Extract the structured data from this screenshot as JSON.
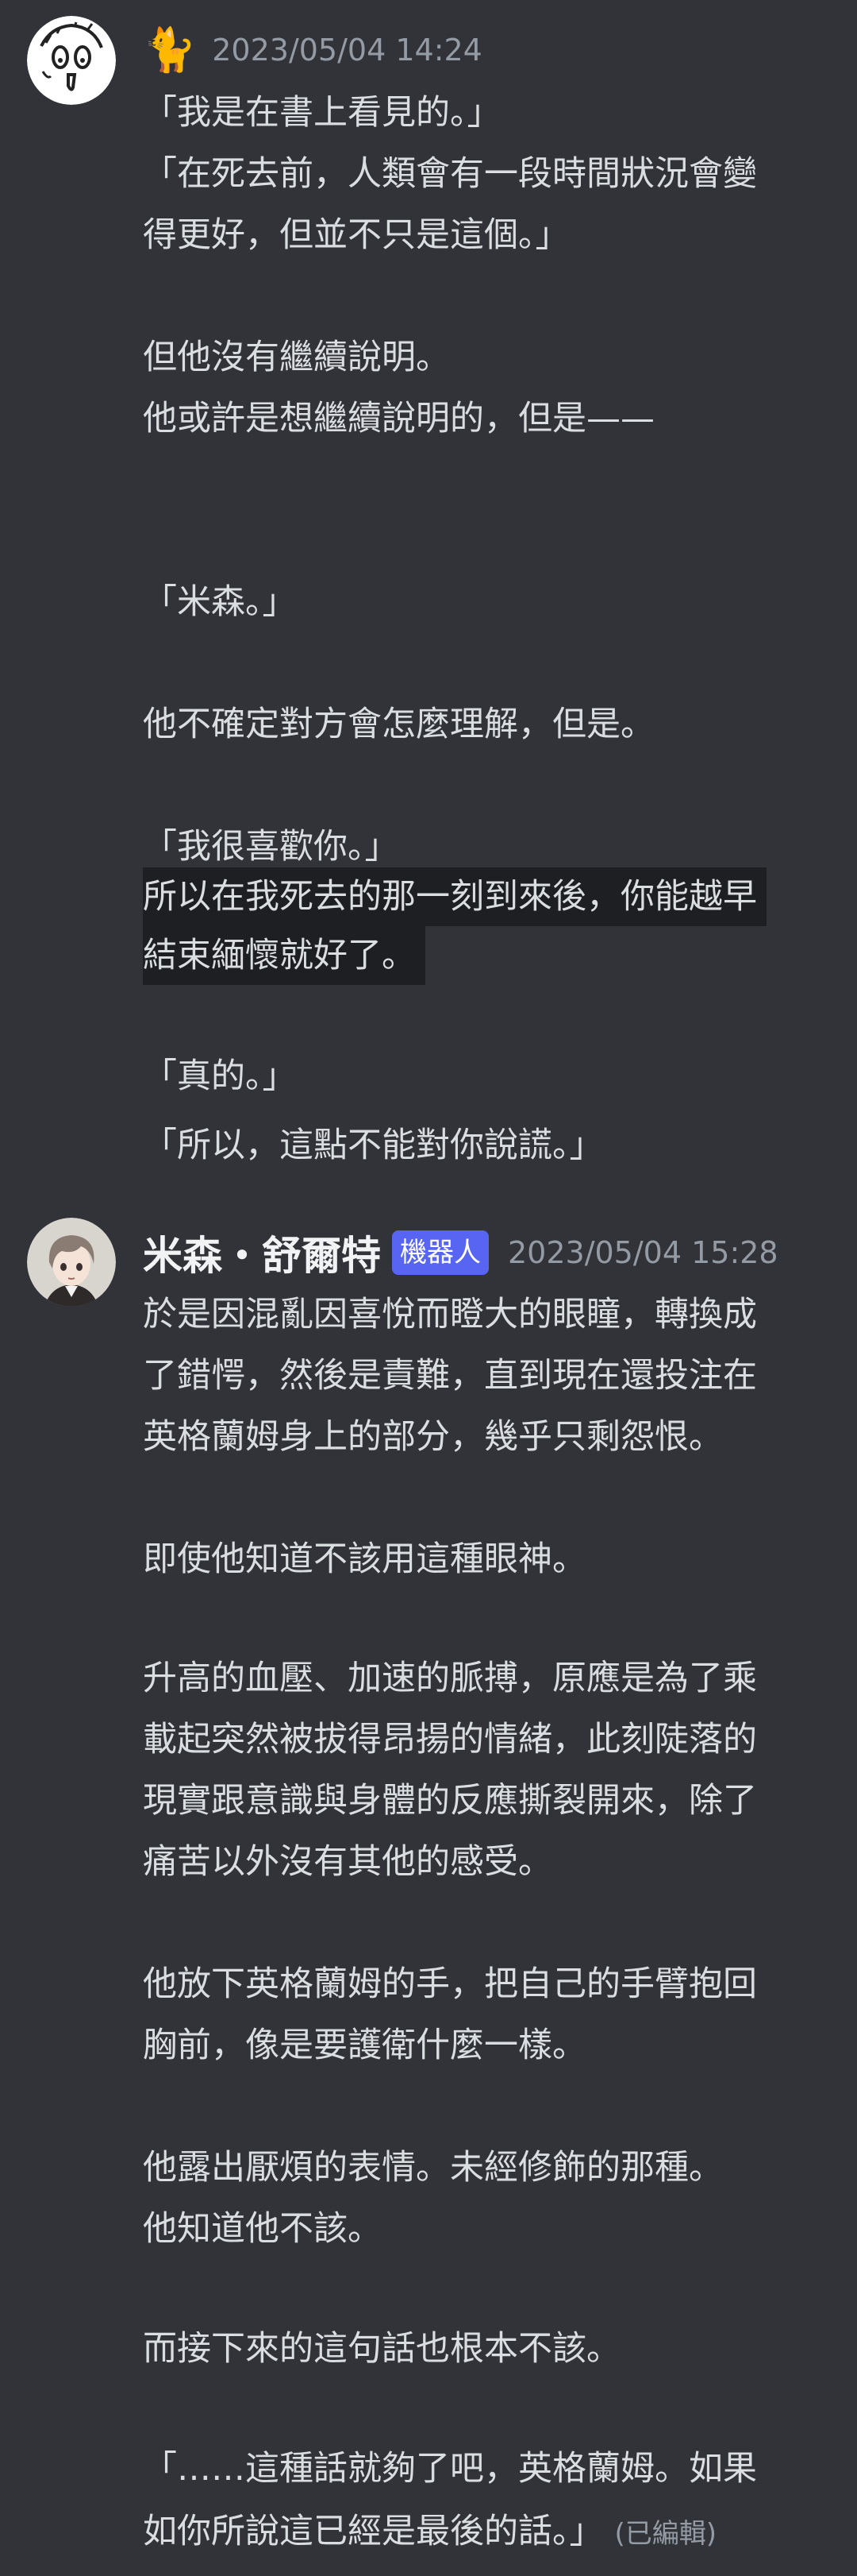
{
  "messages": [
    {
      "author": "",
      "bot_tag": "",
      "timestamp": "2023/05/04 14:24",
      "lines": [
        "「我是在書上看見的。」",
        "「在死去前，人類會有一段時間狀況會變",
        "得更好，但並不只是這個。」",
        "",
        "但他沒有繼續說明。",
        "他或許是想繼續說明的，但是——",
        "",
        "",
        "「米森。」",
        "",
        "他不確定對方會怎麼理解，但是。",
        "",
        "「我很喜歡你。」",
        "所以在我死去的那一刻到來後，你能越早",
        "結束緬懷就好了。",
        "",
        "「真的。」",
        "「所以，這點不能對你說謊。」"
      ]
    },
    {
      "author": "米森・舒爾特",
      "bot_tag": "機器人",
      "timestamp": "2023/05/04 15:28",
      "lines": [
        "於是因混亂因喜悅而瞪大的眼瞳，轉換成",
        "了錯愕，然後是責難，直到現在還投注在",
        "英格蘭姆身上的部分，幾乎只剩怨恨。",
        "",
        "即使他知道不該用這種眼神。",
        "",
        "升高的血壓、加速的脈搏，原應是為了乘",
        "載起突然被拔得昂揚的情緒，此刻陡落的",
        "現實跟意識與身體的反應撕裂開來，除了",
        "痛苦以外沒有其他的感受。",
        "",
        "他放下英格蘭姆的手，把自己的手臂抱回",
        "胸前，像是要護衛什麼一樣。",
        "",
        "他露出厭煩的表情。未經修飾的那種。",
        "他知道他不該。",
        "",
        "而接下來的這句話也根本不該。",
        "",
        "「……這種話就夠了吧，英格蘭姆。如果",
        "如你所說這已經是最後的話。」"
      ],
      "edited": "(已編輯)"
    }
  ],
  "colors": {
    "background": "#313338",
    "text": "#dbdee1",
    "timestamp": "#949ba4",
    "bot_tag": "#5865f2",
    "highlight": "#1e1f22"
  }
}
